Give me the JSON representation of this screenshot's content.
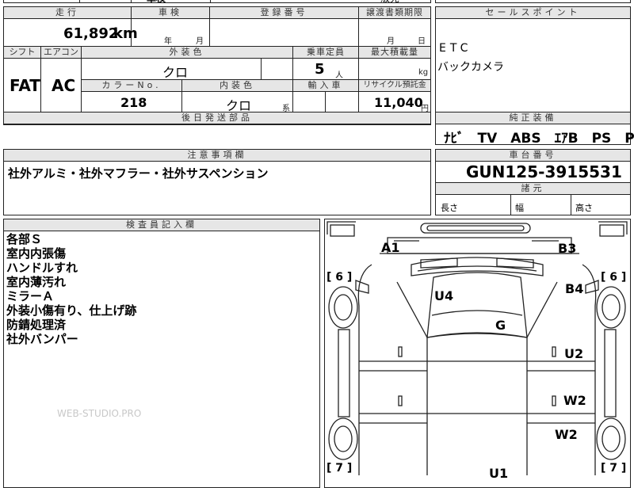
{
  "top_fragments": {
    "cut_text_1": "車検",
    "cut_text_2": "販売"
  },
  "row1": {
    "mileage_label": "走行",
    "mileage_value": "61,892",
    "mileage_unit": "km",
    "shaken_label": "車検",
    "shaken_year": "年",
    "shaken_month": "月",
    "regno_label": "登録番号",
    "transfer_label": "譲渡書類期限",
    "transfer_month": "月",
    "transfer_day": "日"
  },
  "row2": {
    "shift_label": "シフト",
    "ac_label": "エアコン",
    "ext_color_label": "外装色",
    "seats_label": "乗車定員",
    "maxload_label": "最大積載量",
    "shift_value": "FAT",
    "ac_value": "AC",
    "ext_color_value": "クロ",
    "seats_value": "5",
    "seats_unit": "人",
    "maxload_unit": "kg",
    "colorno_label": "カラーNo.",
    "int_color_label": "内装色",
    "import_label": "輸入車",
    "recycle_label": "リサイクル預託金",
    "colorno_value": "218",
    "int_color_value": "クロ",
    "int_color_suffix": "系",
    "recycle_value": "11,040",
    "recycle_unit": "円",
    "parts_label": "後日発送部品"
  },
  "sales": {
    "label": "セールスポイント",
    "lines": [
      "ETC",
      "バックカメラ"
    ]
  },
  "equipment": {
    "label": "純正装備",
    "value": "ﾅﾋﾞ　TV　ABS　ｴｱB　PS　PW"
  },
  "caution": {
    "label": "注意事項欄",
    "value": "社外アルミ・社外マフラー・社外サスペンション"
  },
  "chassis": {
    "label": "車台番号",
    "value": "GUN125-3915531",
    "dims_label": "諸元",
    "length_label": "長さ",
    "width_label": "幅",
    "height_label": "高さ"
  },
  "inspector": {
    "label": "検査員記入欄",
    "notes": [
      "各部Ｓ",
      "室内内張傷",
      "ハンドルすれ",
      "室内薄汚れ",
      "ミラーＡ",
      "外装小傷有り、仕上げ跡",
      "防錆処理済",
      "社外バンパー"
    ]
  },
  "watermark": "WEB-STUDIO.PRO",
  "diagram": {
    "marks": {
      "a1": "A1",
      "b3": "B3",
      "b4": "B4",
      "u4": "U4",
      "g": "G",
      "u2": "U2",
      "w2a": "W2",
      "w2b": "W2",
      "u1": "U1"
    },
    "tire_left_top": "[ 6 ]",
    "tire_right_top": "[ 6 ]",
    "tire_left_bottom": "[ 7 ]",
    "tire_right_bottom": "[ 7 ]"
  }
}
